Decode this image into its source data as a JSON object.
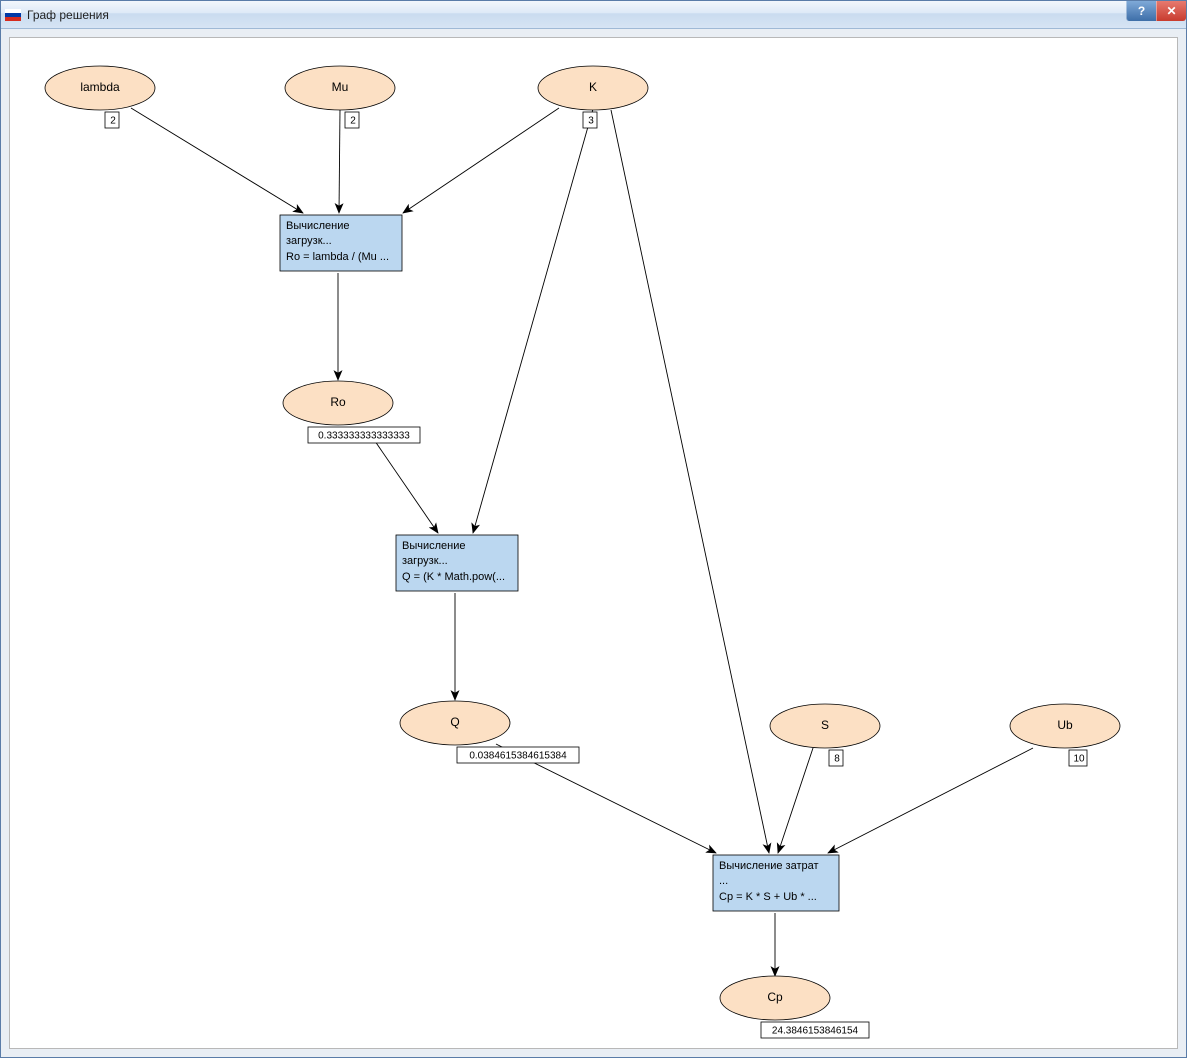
{
  "window": {
    "title": "Граф решения",
    "help_label": "?",
    "close_label": "✕"
  },
  "nodes": {
    "lambda": {
      "label": "lambda",
      "value": "2"
    },
    "mu": {
      "label": "Mu",
      "value": "2"
    },
    "k": {
      "label": "K",
      "value": "3"
    },
    "ro": {
      "label": "Ro",
      "value": "0.333333333333333"
    },
    "q": {
      "label": "Q",
      "value": "0.0384615384615384"
    },
    "s": {
      "label": "S",
      "value": "8"
    },
    "ub": {
      "label": "Ub",
      "value": "10"
    },
    "cp": {
      "label": "Cp",
      "value": "24.3846153846154"
    }
  },
  "calcs": {
    "c1": {
      "line1": "Вычисление",
      "line2": "загрузк...",
      "line3": "Ro = lambda / (Mu ..."
    },
    "c2": {
      "line1": "Вычисление",
      "line2": "загрузк...",
      "line3": "Q = (K * Math.pow(..."
    },
    "c3": {
      "line1": "Вычисление затрат",
      "line2": "...",
      "line3": "Cp = K * S + Ub * ..."
    }
  }
}
